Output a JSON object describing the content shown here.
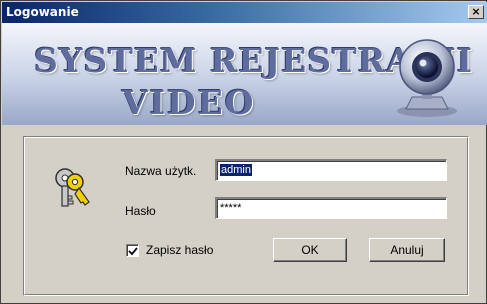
{
  "window": {
    "title": "Logowanie",
    "close_symbol": "×"
  },
  "banner": {
    "line1": "SYSTEM REJESTRACJI",
    "line2": "VIDEO",
    "icon": "webcam-icon"
  },
  "form": {
    "icon": "keys-icon",
    "username_label": "Nazwa użytk.",
    "username_value": "admin",
    "password_label": "Hasło",
    "password_value": "*****",
    "remember_label": "Zapisz hasło",
    "remember_checked": true,
    "ok_label": "OK",
    "cancel_label": "Anuluj"
  },
  "colors": {
    "window_bg": "#d4d0c8",
    "titlebar_start": "#0a246a",
    "titlebar_end": "#a6caf0",
    "banner_text": "#5f6c9e",
    "selection": "#0a246a"
  }
}
